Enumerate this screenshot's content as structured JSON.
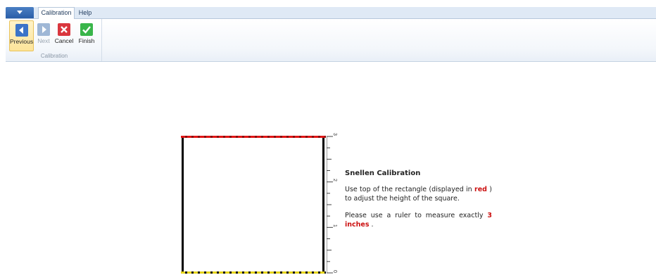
{
  "ribbon": {
    "tabs": [
      {
        "label": "Calibration",
        "active": true
      },
      {
        "label": "Help",
        "active": false
      }
    ],
    "group_label": "Calibration",
    "buttons": [
      {
        "label": "Previous",
        "icon": "arrow-left-icon",
        "color": "#3b74c8",
        "state": "selected"
      },
      {
        "label": "Next",
        "icon": "arrow-right-icon",
        "color": "#9fb7d6",
        "state": "disabled"
      },
      {
        "label": "Cancel",
        "icon": "close-icon",
        "color": "#d9363e",
        "state": "normal"
      },
      {
        "label": "Finish",
        "icon": "check-icon",
        "color": "#39b54a",
        "state": "normal"
      }
    ]
  },
  "ruler": {
    "labels": [
      "3",
      "2",
      "1",
      "0"
    ]
  },
  "instructions": {
    "title": "Snellen Calibration",
    "p1_before": "Use top of the rectangle (displayed in",
    "p1_red": "red",
    "p1_after": ") to adjust the height of the square.",
    "p2_before": "Please use a ruler to measure exactly",
    "p2_red": "3 inches",
    "p2_after": "."
  },
  "colors": {
    "top_edge": "#e01515",
    "bottom_edge": "#e6d51a",
    "highlight": "#cc1111"
  }
}
